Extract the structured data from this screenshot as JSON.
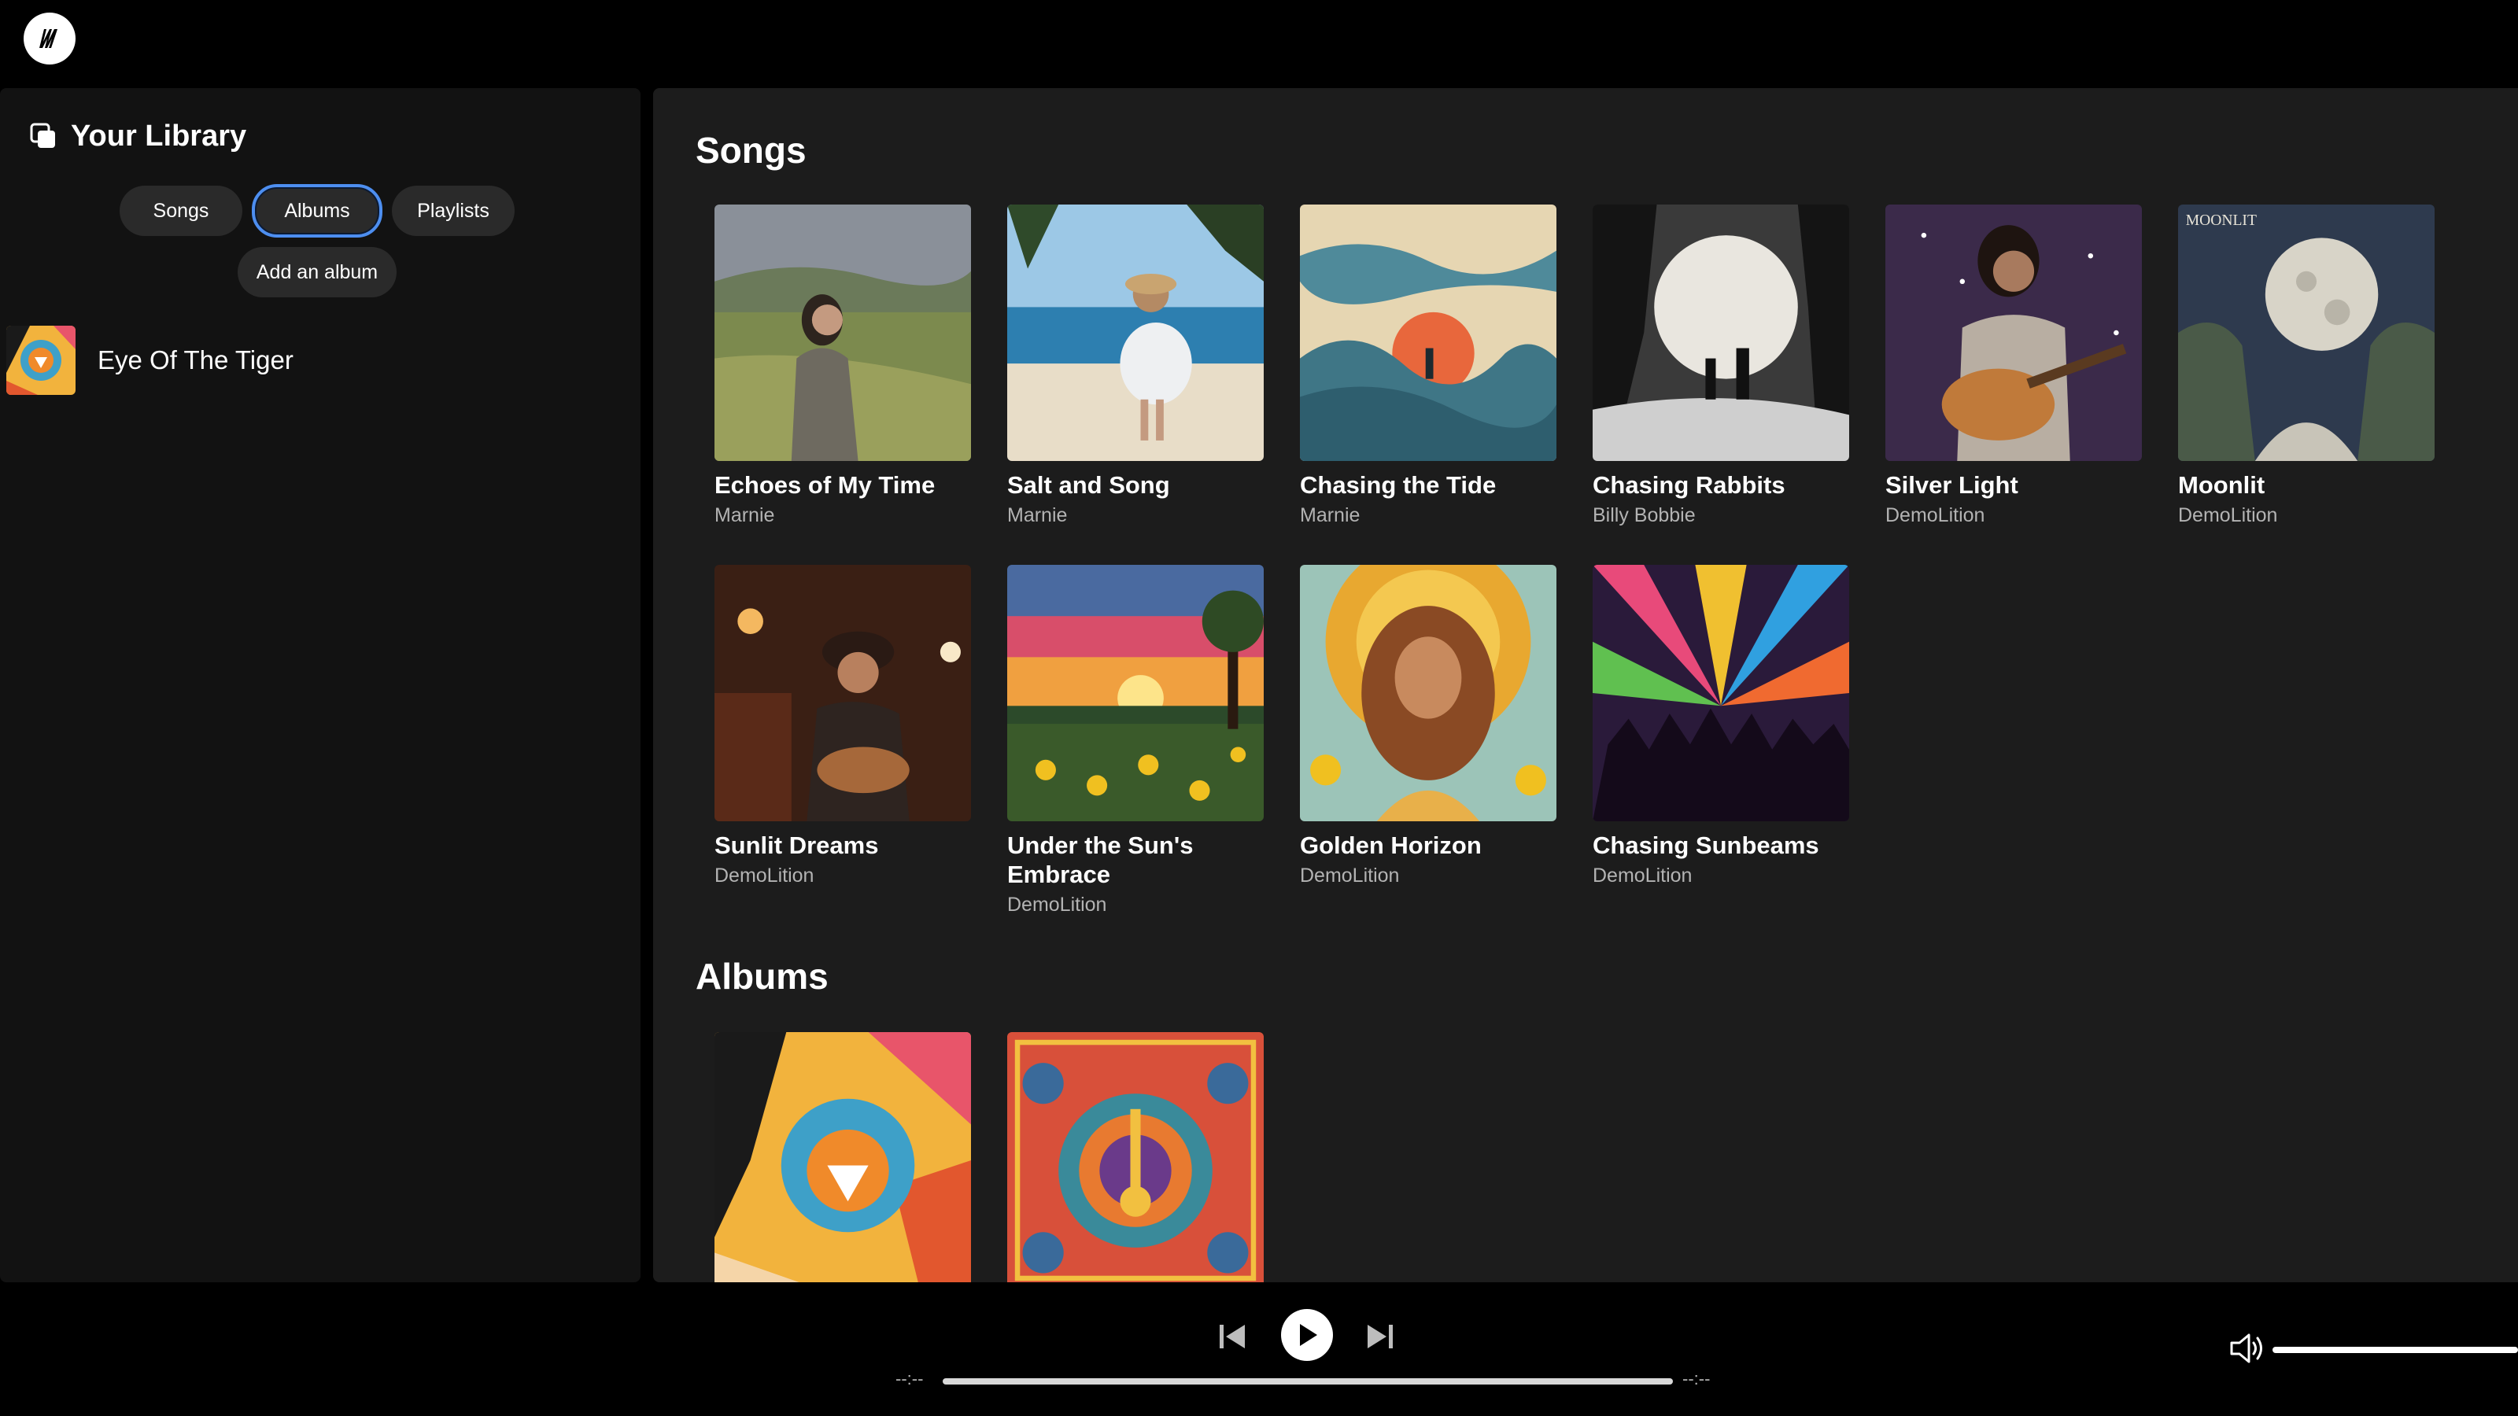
{
  "header": {
    "logo": "app-logo"
  },
  "sidebar": {
    "title": "Your Library",
    "filters": [
      "Songs",
      "Albums",
      "Playlists"
    ],
    "active_filter": "Albums",
    "add_button": "Add an album",
    "items": [
      {
        "label": "Eye Of The Tiger"
      }
    ]
  },
  "main": {
    "songs_title": "Songs",
    "albums_title": "Albums",
    "songs": [
      {
        "title": "Echoes of My Time",
        "artist": "Marnie"
      },
      {
        "title": "Salt and Song",
        "artist": "Marnie"
      },
      {
        "title": "Chasing the Tide",
        "artist": "Marnie"
      },
      {
        "title": "Chasing Rabbits",
        "artist": "Billy Bobbie"
      },
      {
        "title": "Silver Light",
        "artist": "DemoLition"
      },
      {
        "title": "Moonlit",
        "artist": "DemoLition"
      },
      {
        "title": "Sunlit Dreams",
        "artist": "DemoLition"
      },
      {
        "title": "Under the Sun's Embrace",
        "artist": "DemoLition"
      },
      {
        "title": "Golden Horizon",
        "artist": "DemoLition"
      },
      {
        "title": "Chasing Sunbeams",
        "artist": "DemoLition"
      }
    ],
    "moonlit_cover_text": "MOONLIT"
  },
  "player": {
    "time_elapsed": "--:--",
    "time_total": "--:--",
    "volume_level": 1.0
  },
  "colors": {
    "accent": "#4d8ef0",
    "background": "#000000",
    "panel": "#121212",
    "main_panel": "#1c1c1c"
  }
}
